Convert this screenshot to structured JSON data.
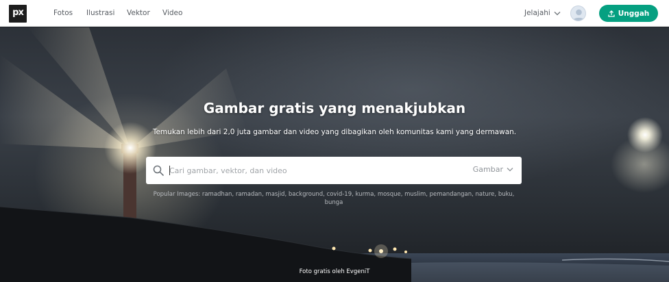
{
  "header": {
    "logo_text": "px",
    "nav": [
      {
        "label": "Fotos"
      },
      {
        "label": "Ilustrasi"
      },
      {
        "label": "Vektor"
      },
      {
        "label": "Video"
      }
    ],
    "explore_label": "Jelajahi",
    "upload_label": "Unggah",
    "upload_icon": "upload-icon",
    "avatar_icon": "user-avatar-icon"
  },
  "hero": {
    "title": "Gambar gratis yang menakjubkan",
    "subtitle": "Temukan lebih dari 2,0 juta gambar dan video yang dibagikan oleh komunitas kami yang dermawan.",
    "search": {
      "placeholder": "Cari gambar, vektor, dan video",
      "value": "",
      "type_selected": "Gambar"
    },
    "popular_label": "Popular Images:",
    "popular_tags": [
      "ramadhan",
      "ramadan",
      "masjid",
      "background",
      "covid-19",
      "kurma",
      "mosque",
      "muslim",
      "pemandangan",
      "nature",
      "buku",
      "bunga"
    ],
    "credit": "Foto gratis oleh EvgeniT"
  },
  "colors": {
    "accent": "#05a081",
    "header_bg": "#ffffff",
    "nav_text": "#555a60"
  }
}
